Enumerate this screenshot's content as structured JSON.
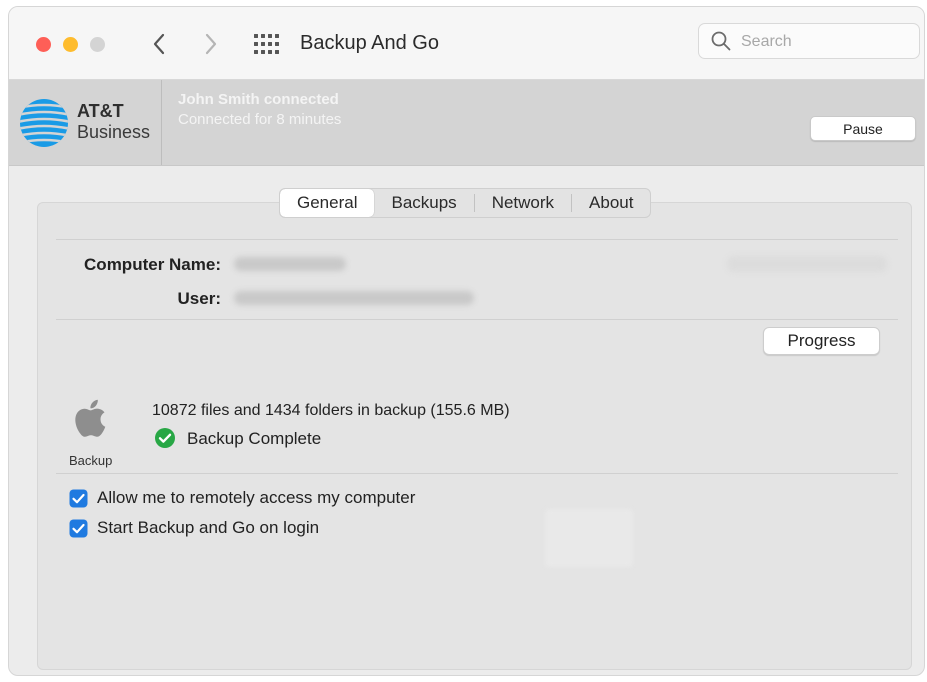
{
  "window": {
    "title": "Backup And Go",
    "search_placeholder": "Search"
  },
  "banner": {
    "brand_line1": "AT&T",
    "brand_line2": "Business",
    "connected_user": "John Smith connected",
    "connected_time": "Connected for 8 minutes",
    "pause_label": "Pause"
  },
  "tabs": [
    {
      "label": "General",
      "active": true
    },
    {
      "label": "Backups",
      "active": false
    },
    {
      "label": "Network",
      "active": false
    },
    {
      "label": "About",
      "active": false
    }
  ],
  "general": {
    "computer_name_label": "Computer Name:",
    "user_label": "User:",
    "progress_label": "Progress",
    "backup_icon_caption": "Backup",
    "backup_summary": "10872 files and 1434 folders in backup (155.6 MB)",
    "backup_status": "Backup Complete",
    "options": [
      {
        "label": "Allow me to remotely access my computer",
        "checked": true
      },
      {
        "label": "Start Backup and Go on login",
        "checked": true
      }
    ]
  },
  "colors": {
    "close": "#fe5f57",
    "minimize": "#febc2e",
    "zoom_inactive": "#d4d4d4",
    "accent_checkbox": "#1f7ae0",
    "status_green": "#28a745",
    "att_blue": "#1a9be6"
  }
}
